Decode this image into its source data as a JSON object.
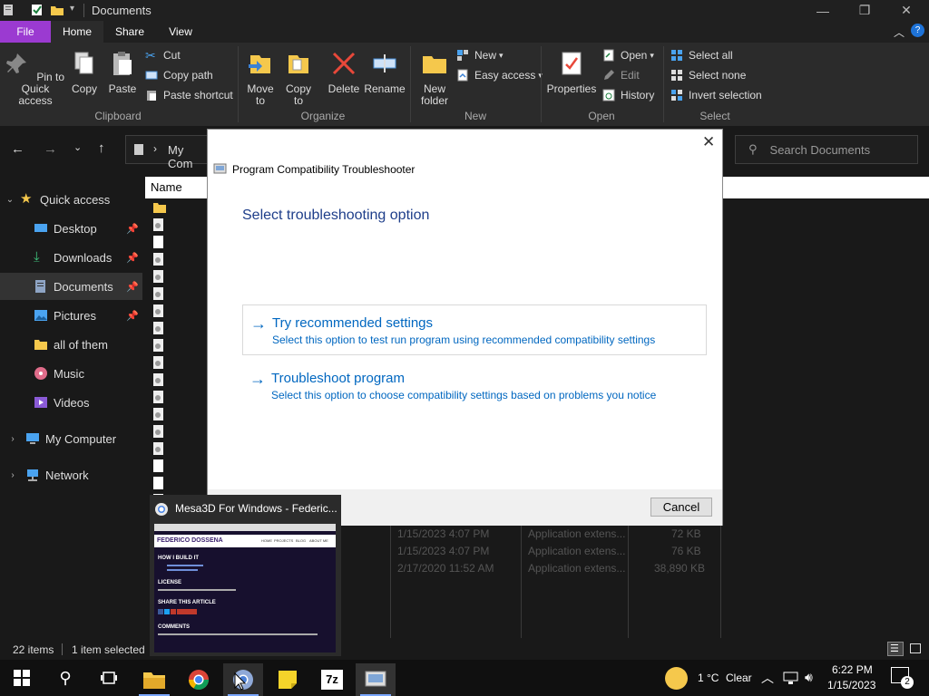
{
  "window": {
    "title": "Documents"
  },
  "tabs": {
    "file": "File",
    "home": "Home",
    "share": "Share",
    "view": "View"
  },
  "ribbon": {
    "pin": "Pin to Quick access",
    "copy": "Copy",
    "paste": "Paste",
    "cut": "Cut",
    "copy_path": "Copy path",
    "paste_shortcut": "Paste shortcut",
    "move_to": "Move to",
    "copy_to": "Copy to",
    "delete": "Delete",
    "rename": "Rename",
    "new_folder": "New folder",
    "new_item": "New",
    "easy_access": "Easy access",
    "properties": "Properties",
    "open": "Open",
    "edit": "Edit",
    "history": "History",
    "select_all": "Select all",
    "select_none": "Select none",
    "invert_selection": "Invert selection",
    "groups": {
      "clipboard": "Clipboard",
      "organize": "Organize",
      "new": "New",
      "open": "Open",
      "select": "Select"
    }
  },
  "address": {
    "path": "My Com",
    "search_placeholder": "Search Documents"
  },
  "nav": {
    "quick_access": "Quick access",
    "desktop": "Desktop",
    "downloads": "Downloads",
    "documents": "Documents",
    "pictures": "Pictures",
    "all_of_them": "all of them",
    "music": "Music",
    "videos": "Videos",
    "my_computer": "My Computer",
    "network": "Network"
  },
  "filelist": {
    "column_name": "Name",
    "ghost": {
      "d1": "1/15/2023 4:07 PM",
      "d2": "1/15/2023 4:07 PM",
      "d3": "2/17/2020 11:52 AM",
      "t1": "Application extens...",
      "t2": "Application extens...",
      "t3": "Application extens...",
      "s1": "72 KB",
      "s2": "76 KB",
      "s3": "38,890 KB"
    }
  },
  "status": {
    "items": "22 items",
    "selected": "1 item selected"
  },
  "dialog": {
    "title": "Program Compatibility Troubleshooter",
    "heading": "Select troubleshooting option",
    "options": [
      {
        "title": "Try recommended settings",
        "desc": "Select this option to test run program using recommended compatibility settings"
      },
      {
        "title": "Troubleshoot program",
        "desc": "Select this option to choose compatibility settings based on problems you notice"
      }
    ],
    "cancel": "Cancel"
  },
  "thumbnail": {
    "title": "Mesa3D For Windows - Federic...",
    "page_title": "FEDERICO DOSSENA",
    "nav": [
      "HOME",
      "PROJECTS",
      "BLOG",
      "ABOUT ME"
    ],
    "how": "HOW I BUILD IT",
    "license": "LICENSE",
    "share": "SHARE THIS ARTICLE",
    "comments": "COMMENTS"
  },
  "taskbar": {
    "weather_temp": "1 °C",
    "weather_text": "Clear",
    "time": "6:22 PM",
    "date": "1/15/2023",
    "notifications": "2"
  },
  "colors": {
    "file_tab": "#9b3ad1",
    "link": "#0067c0",
    "heading": "#1e3e8a"
  }
}
